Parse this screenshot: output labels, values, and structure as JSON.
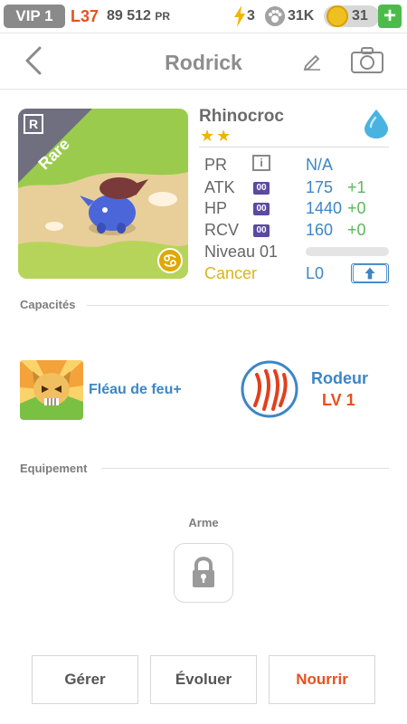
{
  "status_bar": {
    "vip": "VIP 1",
    "level": "L37",
    "pr_value": "89 512",
    "pr_unit": "PR",
    "energy": "3",
    "food": "31K",
    "coins": "31",
    "plus": "+"
  },
  "header": {
    "title": "Rodrick"
  },
  "monster": {
    "rarity": "Rare",
    "rarity_letter": "R",
    "species": "Rhinocroc",
    "stars": "★★",
    "element_icon": "water-drop-icon",
    "stats": {
      "pr_label": "PR",
      "pr_value": "N/A",
      "info_glyph": "i",
      "atk_label": "ATK",
      "atk_value": "175",
      "atk_bonus": "+1",
      "hp_label": "HP",
      "hp_value": "1440",
      "hp_bonus": "+0",
      "rcv_label": "RCV",
      "rcv_value": "160",
      "rcv_bonus": "+0",
      "badge": "00"
    },
    "level_label": "Niveau 01",
    "level_progress": 0,
    "sign": "Cancer",
    "sign_level": "L0"
  },
  "sections": {
    "abilities": "Capacités",
    "equipment": "Equipement"
  },
  "abilities": {
    "first": {
      "name": "Fléau de feu+"
    },
    "second": {
      "name": "Rodeur",
      "level": "LV 1"
    }
  },
  "equipment": {
    "weapon_label": "Arme"
  },
  "buttons": {
    "manage": "Gérer",
    "evolve": "Évoluer",
    "feed": "Nourrir"
  },
  "colors": {
    "accent_blue": "#3d86c6",
    "accent_orange": "#e8501e",
    "bonus_green": "#5cb85c",
    "sign_yellow": "#d9b51a"
  }
}
